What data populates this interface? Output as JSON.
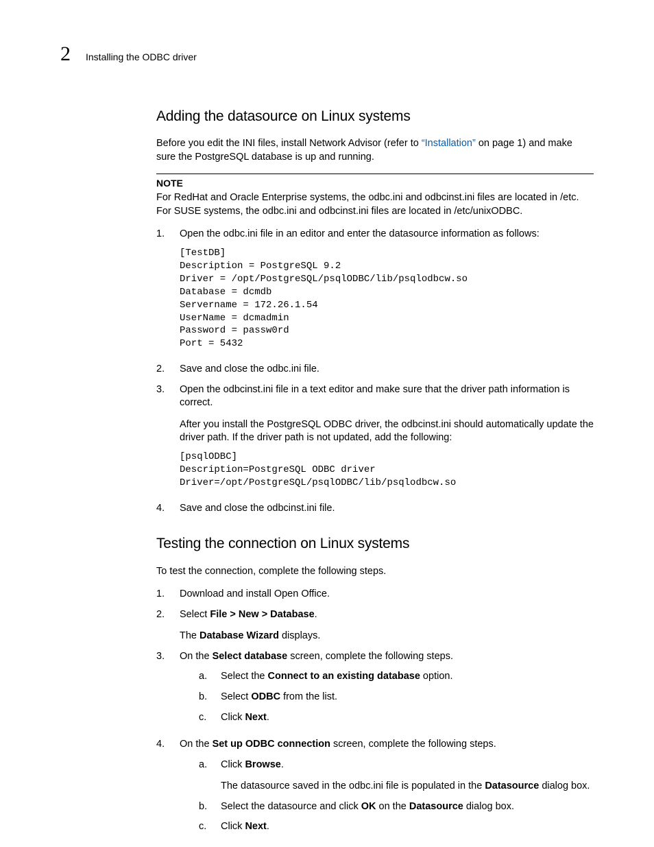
{
  "header": {
    "chapter_number": "2",
    "running_title": "Installing the ODBC driver"
  },
  "section1": {
    "heading": "Adding the datasource on Linux systems",
    "intro_pre": "Before you edit the INI files, install Network Advisor (refer to ",
    "intro_link": "“Installation”",
    "intro_post": " on page 1) and make sure the PostgreSQL database is up and running.",
    "note_label": "NOTE",
    "note_body": "For RedHat and Oracle Enterprise systems, the odbc.ini and odbcinst.ini files are located in /etc. For SUSE systems, the odbc.ini and odbcinst.ini files are located in /etc/unixODBC.",
    "step1_text": "Open the odbc.ini file in an editor and enter the datasource information as follows:",
    "code1": "[TestDB]\nDescription = PostgreSQL 9.2\nDriver = /opt/PostgreSQL/psqlODBC/lib/psqlodbcw.so\nDatabase = dcmdb\nServername = 172.26.1.54\nUserName = dcmadmin\nPassword = passw0rd\nPort = 5432",
    "step2_text": "Save and close the odbc.ini file.",
    "step3_text": "Open the odbcinst.ini file in a text editor and make sure that the driver path information is correct.",
    "step3_after": "After you install the PostgreSQL ODBC driver, the odbcinst.ini should automatically update the driver path. If the driver path is not updated, add the following:",
    "code2": "[psqlODBC]\nDescription=PostgreSQL ODBC driver\nDriver=/opt/PostgreSQL/psqlODBC/lib/psqlodbcw.so",
    "step4_text": "Save and close the odbcinst.ini file."
  },
  "section2": {
    "heading": "Testing the connection on Linux systems",
    "intro": "To test the connection, complete the following steps.",
    "step1": "Download and install Open Office.",
    "step2_pre": "Select ",
    "step2_bold": "File > New > Database",
    "step2_post": ".",
    "step2_sub_pre": "The ",
    "step2_sub_bold": "Database Wizard",
    "step2_sub_post": " displays.",
    "step3_pre": "On the ",
    "step3_bold": "Select database",
    "step3_post": " screen, complete the following steps.",
    "step3a_pre": "Select the ",
    "step3a_bold": "Connect to an existing database",
    "step3a_post": " option.",
    "step3b_pre": "Select ",
    "step3b_bold": "ODBC",
    "step3b_post": " from the list.",
    "step3c_pre": "Click ",
    "step3c_bold": "Next",
    "step3c_post": ".",
    "step4_pre": "On the ",
    "step4_bold": "Set up ODBC connection",
    "step4_post": " screen, complete the following steps.",
    "step4a_pre": "Click ",
    "step4a_bold": "Browse",
    "step4a_post": ".",
    "step4a_sub_pre": "The datasource saved in the odbc.ini file is populated in the ",
    "step4a_sub_bold": "Datasource",
    "step4a_sub_post": " dialog box.",
    "step4b_pre": "Select the datasource and click ",
    "step4b_bold1": "OK",
    "step4b_mid": " on the ",
    "step4b_bold2": "Datasource",
    "step4b_post": " dialog box.",
    "step4c_pre": "Click ",
    "step4c_bold": "Next",
    "step4c_post": "."
  }
}
